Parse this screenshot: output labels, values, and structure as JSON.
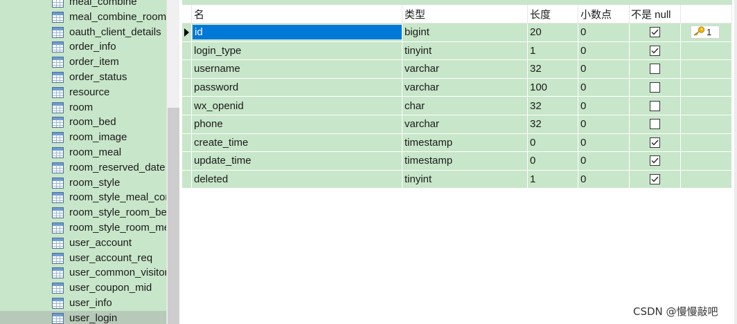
{
  "sidebar": {
    "items": [
      {
        "label": "meal_combine",
        "selected": false
      },
      {
        "label": "meal_combine_room",
        "selected": false
      },
      {
        "label": "oauth_client_details",
        "selected": false
      },
      {
        "label": "order_info",
        "selected": false
      },
      {
        "label": "order_item",
        "selected": false
      },
      {
        "label": "order_status",
        "selected": false
      },
      {
        "label": "resource",
        "selected": false
      },
      {
        "label": "room",
        "selected": false
      },
      {
        "label": "room_bed",
        "selected": false
      },
      {
        "label": "room_image",
        "selected": false
      },
      {
        "label": "room_meal",
        "selected": false
      },
      {
        "label": "room_reserved_date",
        "selected": false
      },
      {
        "label": "room_style",
        "selected": false
      },
      {
        "label": "room_style_meal_combine",
        "selected": false
      },
      {
        "label": "room_style_room_bed",
        "selected": false
      },
      {
        "label": "room_style_room_meal",
        "selected": false
      },
      {
        "label": "user_account",
        "selected": false
      },
      {
        "label": "user_account_req",
        "selected": false
      },
      {
        "label": "user_common_visitor",
        "selected": false
      },
      {
        "label": "user_coupon_mid",
        "selected": false
      },
      {
        "label": "user_info",
        "selected": false
      },
      {
        "label": "user_login",
        "selected": true
      }
    ]
  },
  "grid": {
    "columns": {
      "name": "名",
      "type": "类型",
      "length": "长度",
      "decimals": "小数点",
      "not_null": "不是 null",
      "key": ""
    },
    "rows": [
      {
        "name": "id",
        "type": "bigint",
        "length": "20",
        "decimals": "0",
        "not_null": true,
        "key": "1",
        "editing": true
      },
      {
        "name": "login_type",
        "type": "tinyint",
        "length": "1",
        "decimals": "0",
        "not_null": true,
        "key": ""
      },
      {
        "name": "username",
        "type": "varchar",
        "length": "32",
        "decimals": "0",
        "not_null": false,
        "key": ""
      },
      {
        "name": "password",
        "type": "varchar",
        "length": "100",
        "decimals": "0",
        "not_null": false,
        "key": ""
      },
      {
        "name": "wx_openid",
        "type": "char",
        "length": "32",
        "decimals": "0",
        "not_null": false,
        "key": ""
      },
      {
        "name": "phone",
        "type": "varchar",
        "length": "32",
        "decimals": "0",
        "not_null": false,
        "key": ""
      },
      {
        "name": "create_time",
        "type": "timestamp",
        "length": "0",
        "decimals": "0",
        "not_null": true,
        "key": ""
      },
      {
        "name": "update_time",
        "type": "timestamp",
        "length": "0",
        "decimals": "0",
        "not_null": true,
        "key": ""
      },
      {
        "name": "deleted",
        "type": "tinyint",
        "length": "1",
        "decimals": "0",
        "not_null": true,
        "key": ""
      }
    ]
  },
  "watermark": "CSDN @慢慢敲吧",
  "colors": {
    "row_bg": "#c8e6c9",
    "selection": "#0078d7",
    "key_icon": "#f0b400"
  }
}
